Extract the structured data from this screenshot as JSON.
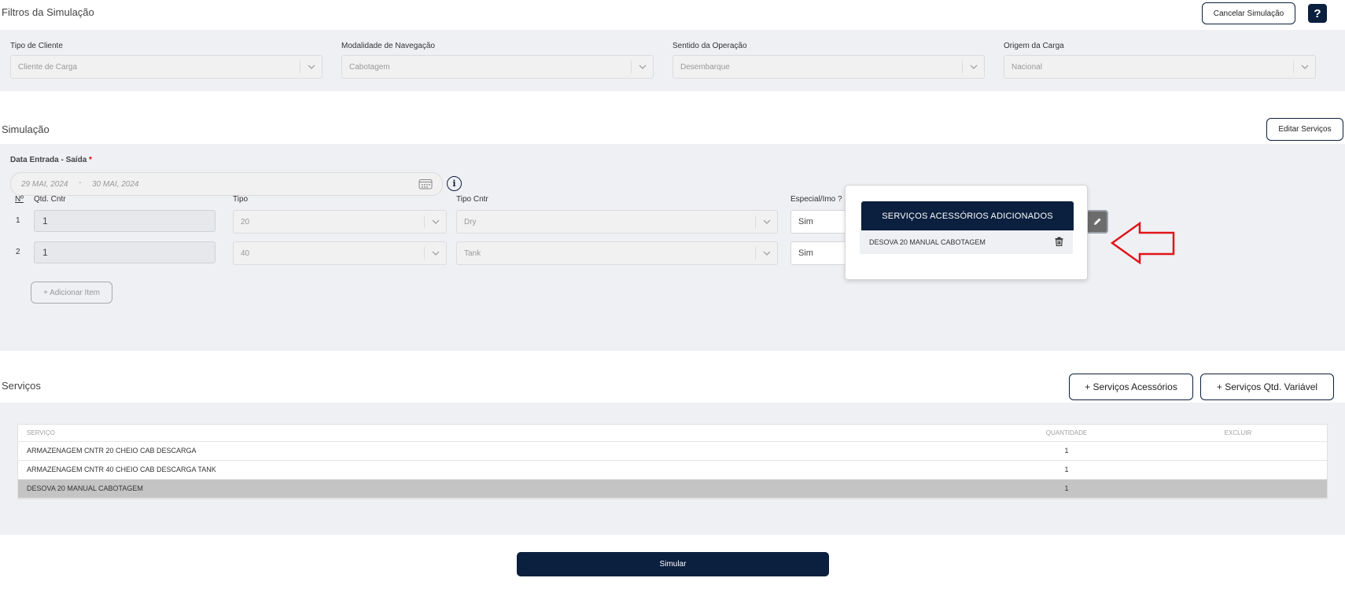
{
  "filters": {
    "title": "Filtros da Simulação",
    "cancel_label": "Cancelar Simulação",
    "help_label": "?",
    "fields": [
      {
        "label": "Tipo de Cliente",
        "value": "Cliente de Carga"
      },
      {
        "label": "Modalidade de Navegação",
        "value": "Cabotagem"
      },
      {
        "label": "Sentido da Operação",
        "value": "Desembarque"
      },
      {
        "label": "Origem da Carga",
        "value": "Nacional"
      }
    ]
  },
  "simulation": {
    "title": "Simulação",
    "edit_services_label": "Editar Serviços",
    "date_label": "Data Entrada - Saída",
    "required_mark": "*",
    "date_start": "29 MAI, 2024",
    "date_sep": "-",
    "date_end": "30 MAI, 2024",
    "info_label": "i",
    "columns": {
      "n": "Nº",
      "qty": "Qtd. Cntr",
      "type": "Tipo",
      "cntr_type": "Tipo Cntr",
      "special": "Especial/Imo ?"
    },
    "rows": [
      {
        "n": "1",
        "qty": "1",
        "type": "20",
        "cntr_type": "Dry",
        "special": "Sim"
      },
      {
        "n": "2",
        "qty": "1",
        "type": "40",
        "cntr_type": "Tank",
        "special": "Sim"
      }
    ],
    "add_item_label": "+ Adicionar Item"
  },
  "popup": {
    "title": "SERVIÇOS ACESSÓRIOS ADICIONADOS",
    "items": [
      {
        "label": "DESOVA 20 MANUAL CABOTAGEM"
      }
    ]
  },
  "services": {
    "title": "Serviços",
    "btn_accessories": "+ Serviços Acessórios",
    "btn_variable": "+ Serviços Qtd. Variável",
    "headers": {
      "service": "SERVIÇO",
      "qty": "QUANTIDADE",
      "delete": "EXCLUIR"
    },
    "rows": [
      {
        "service": "ARMAZENAGEM CNTR 20 CHEIO CAB DESCARGA",
        "qty": "1"
      },
      {
        "service": "ARMAZENAGEM CNTR 40 CHEIO CAB DESCARGA TANK",
        "qty": "1"
      },
      {
        "service": "DESOVA 20 MANUAL CABOTAGEM",
        "qty": "1"
      }
    ]
  },
  "simulate_label": "Simular",
  "colors": {
    "primary": "#0b1f3f",
    "panel": "#eff0f4",
    "highlight_row": "#c4c4c4",
    "arrow": "#e0141b"
  },
  "icons": [
    "chevron-down-icon",
    "calendar-icon",
    "info-icon",
    "trash-icon",
    "pencil-icon",
    "red-arrow-annotation"
  ]
}
